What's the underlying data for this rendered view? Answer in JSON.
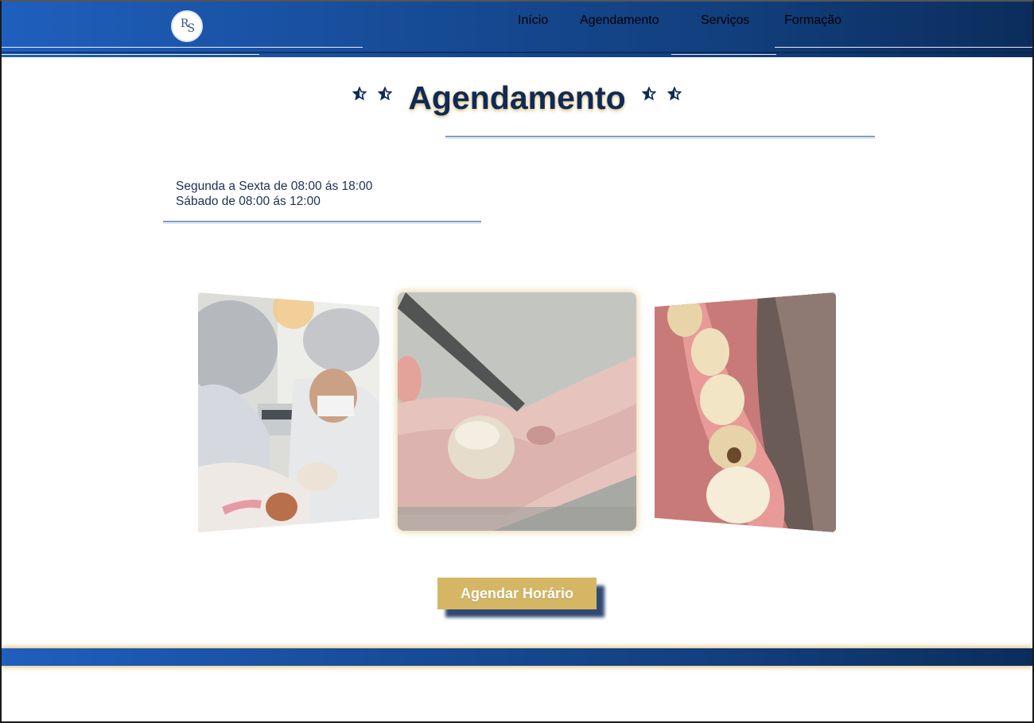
{
  "header": {
    "logo_letters": [
      "R",
      "S"
    ],
    "nav": [
      {
        "label": "Início"
      },
      {
        "label": "Agendamento"
      },
      {
        "label": "Serviços"
      },
      {
        "label": "Formação"
      }
    ]
  },
  "page": {
    "title": "Agendamento",
    "hours": [
      "Segunda a Sexta de 08:00 ás 18:00",
      "Sábado de 08:00 ás 12:00"
    ]
  },
  "carousel": {
    "slides": [
      {
        "icon": "photo-dental-surgery"
      },
      {
        "icon": "photo-dental-crown-model"
      },
      {
        "icon": "photo-molar-teeth"
      }
    ],
    "dot_count": 9,
    "active_index": 1
  },
  "cta": {
    "label": "Agendar Horário"
  },
  "colors": {
    "navy": "#0e2a57",
    "header_start": "#1f5fbd",
    "header_end": "#0c2d5c",
    "gold": "#d4b664",
    "dot_active": "#1f6fe0"
  }
}
